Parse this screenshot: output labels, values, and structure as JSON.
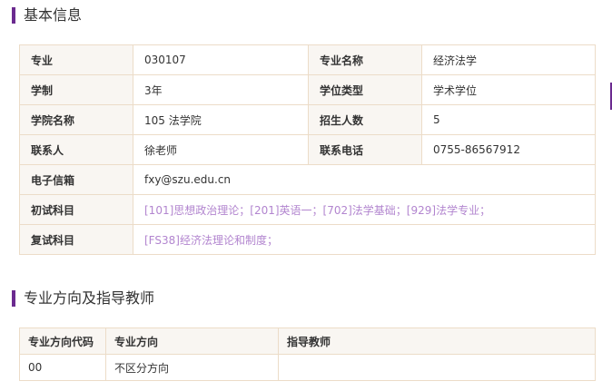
{
  "basic_info": {
    "title": "基本信息",
    "major_label": "专业",
    "major_value": "030107",
    "major_name_label": "专业名称",
    "major_name_value": "经济法学",
    "duration_label": "学制",
    "duration_value": "3年",
    "degree_type_label": "学位类型",
    "degree_type_value": "学术学位",
    "college_label": "学院名称",
    "college_value": "105 法学院",
    "enrollment_label": "招生人数",
    "enrollment_value": "5",
    "contact_label": "联系人",
    "contact_value": "徐老师",
    "phone_label": "联系电话",
    "phone_value": "0755-86567912",
    "email_label": "电子信箱",
    "email_value": "fxy@szu.edu.cn",
    "exam_label": "初试科目",
    "exam_value": "[101]思想政治理论；[201]英语一；[702]法学基础；[929]法学专业；",
    "retest_label": "复试科目",
    "retest_value": "[FS38]经济法理论和制度；"
  },
  "directions": {
    "title": "专业方向及指导教师",
    "headers": [
      "专业方向代码",
      "专业方向",
      "指导教师"
    ],
    "rows": [
      [
        "00",
        "不区分方向",
        ""
      ]
    ]
  },
  "colors": {
    "accent": "#6b2a8f",
    "link": "#b285cf",
    "border": "#ecdcc8",
    "label_bg": "#f9f6f2"
  }
}
